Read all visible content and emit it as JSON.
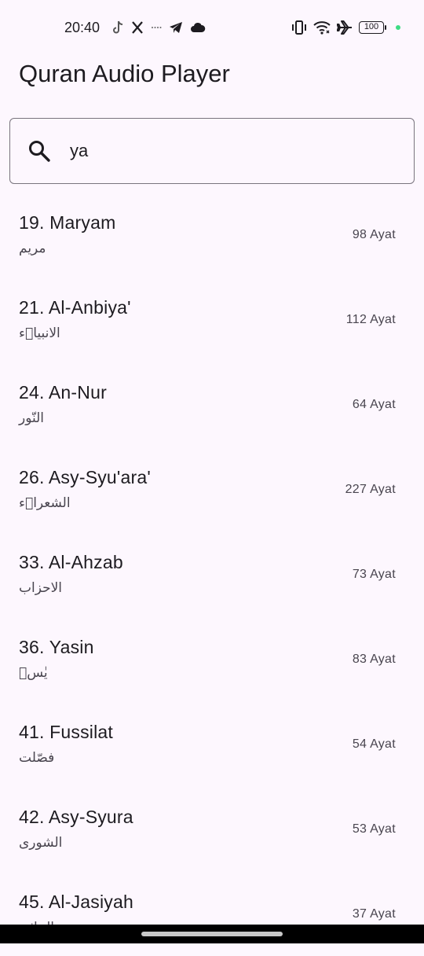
{
  "status_bar": {
    "time": "20:40",
    "battery": "100",
    "left_icons": [
      "tiktok-icon",
      "x-icon",
      "more-dots-icon",
      "telegram-icon",
      "cloud-icon"
    ],
    "right_icons": [
      "vibrate-icon",
      "wifi-icon",
      "airplane-icon",
      "battery-icon"
    ]
  },
  "app": {
    "title": "Quran Audio Player"
  },
  "search": {
    "value": "ya",
    "icon": "search-icon"
  },
  "surahs": [
    {
      "name": "19. Maryam",
      "arabic": "مريم",
      "ayat": "98 Ayat"
    },
    {
      "name": "21. Al-Anbiya'",
      "arabic": "الانبياۤء",
      "ayat": "112 Ayat"
    },
    {
      "name": "24. An-Nur",
      "arabic": "النّور",
      "ayat": "64 Ayat"
    },
    {
      "name": "26. Asy-Syu'ara'",
      "arabic": "الشعراۤء",
      "ayat": "227 Ayat"
    },
    {
      "name": "33. Al-Ahzab",
      "arabic": "الاحزاب",
      "ayat": "73 Ayat"
    },
    {
      "name": "36. Yasin",
      "arabic": "يٰسۤ",
      "ayat": "83 Ayat"
    },
    {
      "name": "41. Fussilat",
      "arabic": "فصّلت",
      "ayat": "54 Ayat"
    },
    {
      "name": "42. Asy-Syura",
      "arabic": "الشورى",
      "ayat": "53 Ayat"
    },
    {
      "name": "45. Al-Jasiyah",
      "arabic": "الجاثية",
      "ayat": "37 Ayat"
    }
  ],
  "colors": {
    "background": "#fdf7fe",
    "text_primary": "#1d1b20",
    "text_secondary": "#49454f",
    "outline": "#79747e"
  }
}
